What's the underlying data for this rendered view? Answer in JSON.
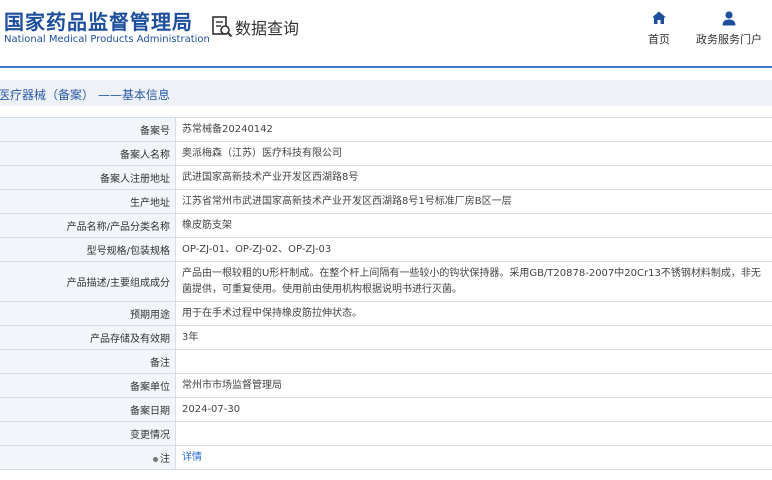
{
  "header": {
    "logo_cn": "国家药品监督管理局",
    "logo_en": "National Medical Products Administration",
    "query_label": "数据查询",
    "nav": [
      {
        "icon": "home-icon",
        "label": "首页"
      },
      {
        "icon": "user-icon",
        "label": "政务服务门户"
      }
    ]
  },
  "breadcrumb": "医疗器械（备案） ——基本信息",
  "records": [
    {
      "label": "备案号",
      "value": "苏常械备20240142"
    },
    {
      "label": "备案人名称",
      "value": "奥派梅森（江苏）医疗科技有限公司"
    },
    {
      "label": "备案人注册地址",
      "value": "武进国家高新技术产业开发区西湖路8号"
    },
    {
      "label": "生产地址",
      "value": "江苏省常州市武进国家高新技术产业开发区西湖路8号1号标准厂房B区一层"
    },
    {
      "label": "产品名称/产品分类名称",
      "value": "橡皮筋支架"
    },
    {
      "label": "型号规格/包装规格",
      "value": "OP-ZJ-01、OP-ZJ-02、OP-ZJ-03"
    },
    {
      "label": "产品描述/主要组成成分",
      "value": "产品由一根较粗的U形杆制成。在整个杆上间隔有一些较小的钩状保持器。采用GB/T20878-2007中20Cr13不锈钢材料制成，非无菌提供，可重复使用。使用前由使用机构根据说明书进行灭菌。"
    },
    {
      "label": "预期用途",
      "value": "用于在手术过程中保持橡皮筋拉伸状态。"
    },
    {
      "label": "产品存储及有效期",
      "value": "3年"
    },
    {
      "label": "备注",
      "value": ""
    },
    {
      "label": "备案单位",
      "value": "常州市市场监督管理局"
    },
    {
      "label": "备案日期",
      "value": "2024-07-30"
    },
    {
      "label": "变更情况",
      "value": ""
    },
    {
      "label": "注",
      "value": "详情"
    }
  ],
  "colors": {
    "brand": "#1d4f9c",
    "accent": "#3f75c5",
    "link": "#2a6bd1",
    "label_bg": "#f2f5f9"
  }
}
